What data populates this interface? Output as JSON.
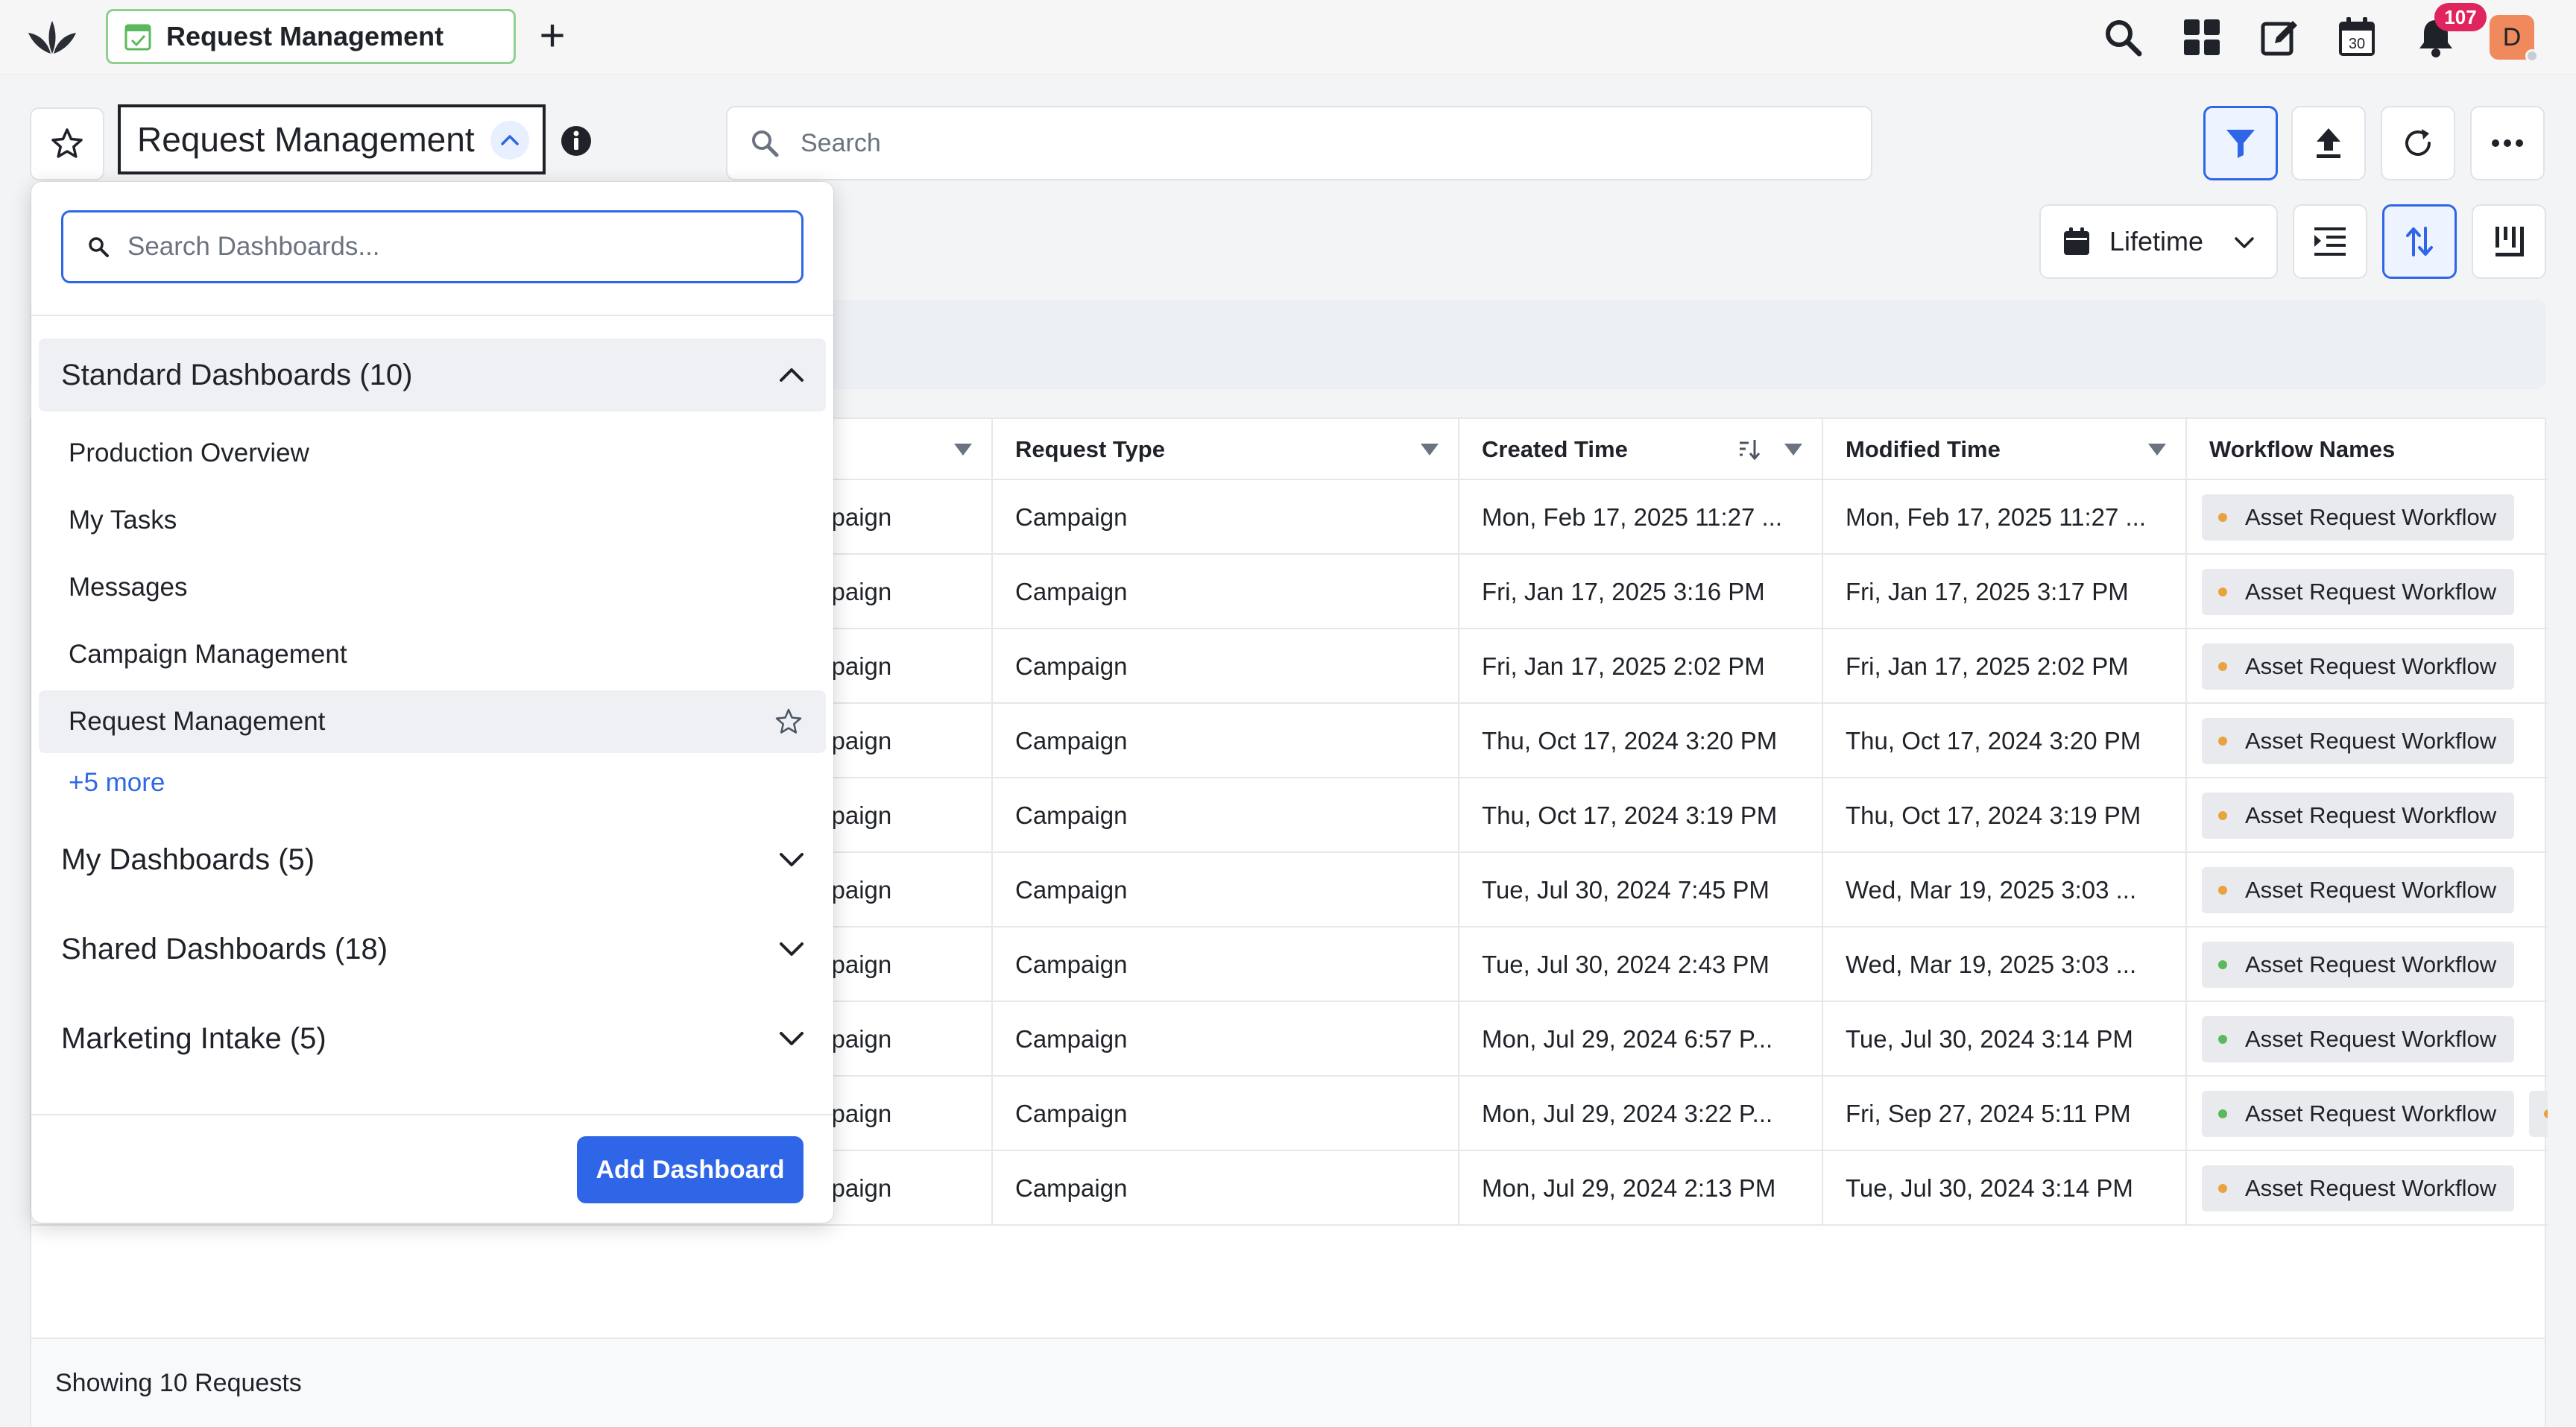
{
  "topbar": {
    "tab_label": "Request Management",
    "new_tab_symbol": "+",
    "notification_count": "107",
    "avatar_initial": "D",
    "calendar_day": "30",
    "icons": [
      "logo-icon",
      "search-icon",
      "apps-grid-icon",
      "edit-icon",
      "calendar-icon",
      "bell-icon"
    ]
  },
  "header": {
    "dashboard_title": "Request Management",
    "search_placeholder": "Search",
    "date_range": "Lifetime"
  },
  "table": {
    "columns": [
      {
        "label": ""
      },
      {
        "label": "Request Type"
      },
      {
        "label": "Created Time"
      },
      {
        "label": "Modified Time"
      },
      {
        "label": "Workflow Names"
      }
    ],
    "rows": [
      {
        "name": "mpaign",
        "type": "Campaign",
        "created": "Mon, Feb 17, 2025 11:27 ...",
        "modified": "Mon, Feb 17, 2025 11:27 ...",
        "workflow": "Asset Request Workflow",
        "status_color": "#e8a33d"
      },
      {
        "name": "mpaign",
        "type": "Campaign",
        "created": "Fri, Jan 17, 2025 3:16 PM",
        "modified": "Fri, Jan 17, 2025 3:17 PM",
        "workflow": "Asset Request Workflow",
        "status_color": "#e8a33d"
      },
      {
        "name": "mpaign",
        "type": "Campaign",
        "created": "Fri, Jan 17, 2025 2:02 PM",
        "modified": "Fri, Jan 17, 2025 2:02 PM",
        "workflow": "Asset Request Workflow",
        "status_color": "#e8a33d"
      },
      {
        "name": "mpaign",
        "type": "Campaign",
        "created": "Thu, Oct 17, 2024 3:20 PM",
        "modified": "Thu, Oct 17, 2024 3:20 PM",
        "workflow": "Asset Request Workflow",
        "status_color": "#e8a33d"
      },
      {
        "name": "mpaign",
        "type": "Campaign",
        "created": "Thu, Oct 17, 2024 3:19 PM",
        "modified": "Thu, Oct 17, 2024 3:19 PM",
        "workflow": "Asset Request Workflow",
        "status_color": "#e8a33d"
      },
      {
        "name": "mpaign",
        "type": "Campaign",
        "created": "Tue, Jul 30, 2024 7:45 PM",
        "modified": "Wed, Mar 19, 2025 3:03 ...",
        "workflow": "Asset Request Workflow",
        "status_color": "#e8a33d"
      },
      {
        "name": "mpaign",
        "type": "Campaign",
        "created": "Tue, Jul 30, 2024 2:43 PM",
        "modified": "Wed, Mar 19, 2025 3:03 ...",
        "workflow": "Asset Request Workflow",
        "status_color": "#5cb85c"
      },
      {
        "name": "mpaign",
        "type": "Campaign",
        "created": "Mon, Jul 29, 2024 6:57 P...",
        "modified": "Tue, Jul 30, 2024 3:14 PM",
        "workflow": "Asset Request Workflow",
        "status_color": "#5cb85c"
      },
      {
        "name": "mpaign",
        "type": "Campaign",
        "created": "Mon, Jul 29, 2024 3:22 P...",
        "modified": "Fri, Sep 27, 2024 5:11 PM",
        "workflow": "Asset Request Workflow",
        "status_color": "#5cb85c",
        "extra_chip": true
      },
      {
        "name": "mpaign",
        "type": "Campaign",
        "created": "Mon, Jul 29, 2024 2:13 PM",
        "modified": "Tue, Jul 30, 2024 3:14 PM",
        "workflow": "Asset Request Workflow",
        "status_color": "#e8a33d"
      }
    ],
    "footer_text": "Showing 10 Requests"
  },
  "dropdown": {
    "search_placeholder": "Search Dashboards...",
    "standard_group": "Standard Dashboards (10)",
    "items": [
      "Production Overview",
      "My Tasks",
      "Messages",
      "Campaign Management",
      "Request Management"
    ],
    "more_link": "+5 more",
    "groups": [
      "My Dashboards (5)",
      "Shared Dashboards (18)",
      "Marketing Intake (5)"
    ],
    "add_button": "Add Dashboard"
  },
  "colors": {
    "accent": "#2f66e8",
    "pending_dot": "#e8a33d",
    "done_dot": "#5cb85c",
    "badge": "#e0245e",
    "avatar": "#f08a5d"
  }
}
